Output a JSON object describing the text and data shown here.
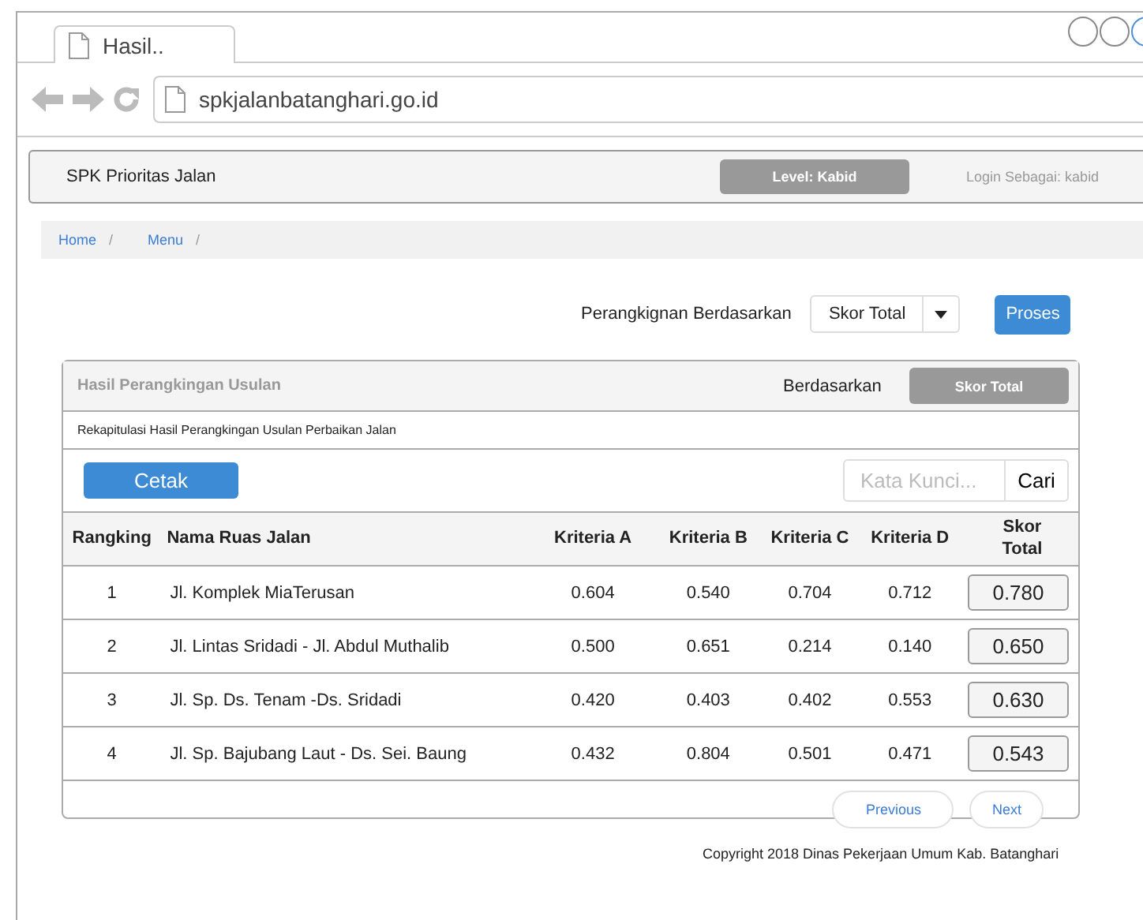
{
  "browser": {
    "tab_title": "Hasil..",
    "url": "spkjalanbatanghari.go.id"
  },
  "navbar": {
    "brand": "SPK Prioritas Jalan",
    "level": "Level: Kabid",
    "login": "Login Sebagai: kabid"
  },
  "breadcrumb": [
    {
      "label": "Home",
      "separator": "/"
    },
    {
      "label": "Menu",
      "separator": "/"
    }
  ],
  "ranking_form": {
    "label": "Perangkignan Berdasarkan",
    "select_value": "Skor Total",
    "button": "Proses"
  },
  "panel": {
    "title": "Hasil Perangkingan Usulan",
    "by_label": "Berdasarkan",
    "by_value": "Skor Total",
    "subtitle": "Rekapitulasi Hasil Perangkingan Usulan Perbaikan Jalan",
    "print_button": "Cetak",
    "search_placeholder": "Kata Kunci...",
    "search_button": "Cari",
    "columns": [
      "Rangking",
      "Nama Ruas Jalan",
      "Kriteria A",
      "Kriteria B",
      "Kriteria C",
      "Kriteria D",
      "Skor Total"
    ],
    "rows": [
      [
        "1",
        "Jl. Komplek MiaTerusan",
        "0.604",
        "0.540",
        "0.704",
        "0.712",
        "0.780"
      ],
      [
        "2",
        "Jl. Lintas Sridadi - Jl. Abdul Muthalib",
        "0.500",
        "0.651",
        "0.214",
        "0.140",
        "0.650"
      ],
      [
        "3",
        "Jl. Sp. Ds. Tenam -Ds. Sridadi",
        "0.420",
        "0.403",
        "0.402",
        "0.553",
        "0.630"
      ],
      [
        "4",
        "Jl. Sp. Bajubang Laut - Ds. Sei. Baung",
        "0.432",
        "0.804",
        "0.501",
        "0.471",
        "0.543"
      ]
    ],
    "pagination": [
      "Previous",
      "Next"
    ]
  },
  "footer": "Copyright 2018  Dinas Pekerjaan Umum Kab. Batanghari"
}
